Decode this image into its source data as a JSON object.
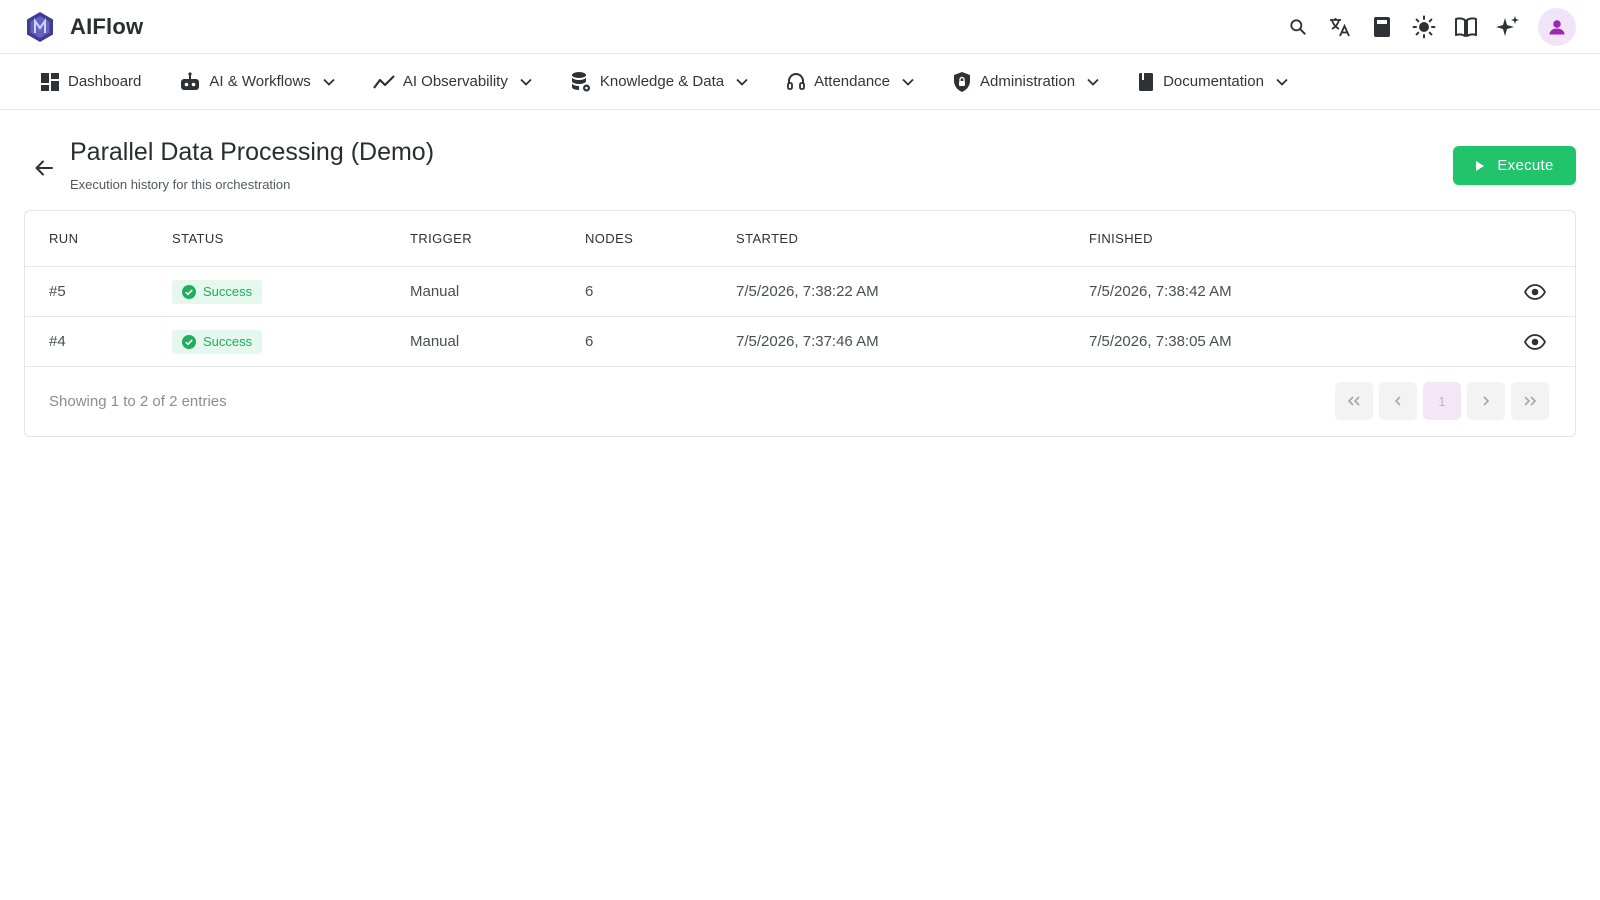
{
  "app": {
    "name": "AIFlow"
  },
  "nav": {
    "items": [
      {
        "label": "Dashboard"
      },
      {
        "label": "AI & Workflows"
      },
      {
        "label": "AI Observability"
      },
      {
        "label": "Knowledge & Data"
      },
      {
        "label": "Attendance"
      },
      {
        "label": "Administration"
      },
      {
        "label": "Documentation"
      }
    ]
  },
  "page": {
    "title": "Parallel Data Processing (Demo)",
    "subtitle": "Execution history for this orchestration",
    "execute_label": "Execute"
  },
  "table": {
    "headers": {
      "run": "RUN",
      "status": "STATUS",
      "trigger": "TRIGGER",
      "nodes": "NODES",
      "started": "STARTED",
      "finished": "FINISHED"
    },
    "rows": [
      {
        "run": "#5",
        "status": "Success",
        "trigger": "Manual",
        "nodes": "6",
        "started": "7/5/2026, 7:38:22 AM",
        "finished": "7/5/2026, 7:38:42 AM"
      },
      {
        "run": "#4",
        "status": "Success",
        "trigger": "Manual",
        "nodes": "6",
        "started": "7/5/2026, 7:37:46 AM",
        "finished": "7/5/2026, 7:38:05 AM"
      }
    ]
  },
  "pagination": {
    "summary": "Showing 1 to 2 of 2 entries",
    "current_page": "1"
  },
  "colors": {
    "accent": "#21c36b",
    "success_bg": "#e6f7ee",
    "success_text": "#1fae5c",
    "avatar_bg": "#f1e4f6",
    "avatar_icon": "#9c27b0"
  },
  "icons": {
    "top_actions": [
      "search-icon",
      "translate-icon",
      "calculator-icon",
      "theme-sun-icon",
      "book-open-icon",
      "sparkles-icon",
      "user-avatar-icon"
    ],
    "nav": [
      "dashboard-icon",
      "robot-icon",
      "trend-line-icon",
      "database-gear-icon",
      "headset-icon",
      "shield-lock-icon",
      "book-icon"
    ]
  }
}
